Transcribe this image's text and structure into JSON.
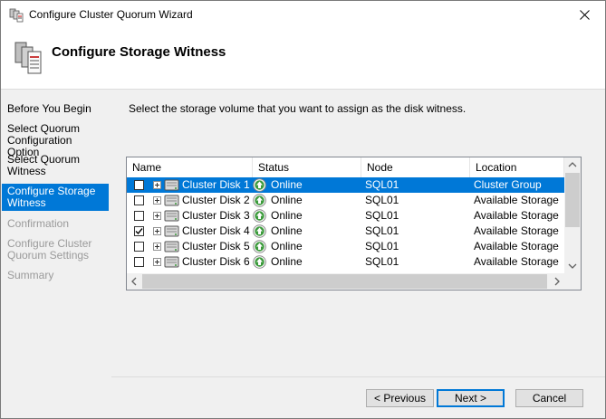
{
  "window": {
    "title": "Configure Cluster Quorum Wizard"
  },
  "header": {
    "title": "Configure Storage Witness"
  },
  "nav": [
    {
      "label": "Before You Begin",
      "state": "done"
    },
    {
      "label": "Select Quorum Configuration Option",
      "state": "done"
    },
    {
      "label": "Select Quorum Witness",
      "state": "done"
    },
    {
      "label": "Configure Storage Witness",
      "state": "active"
    },
    {
      "label": "Confirmation",
      "state": "disabled"
    },
    {
      "label": "Configure Cluster Quorum Settings",
      "state": "disabled"
    },
    {
      "label": "Summary",
      "state": "disabled"
    }
  ],
  "instruction": "Select the storage volume that you want to assign as the disk witness.",
  "grid": {
    "columns": [
      "Name",
      "Status",
      "Node",
      "Location"
    ],
    "rows": [
      {
        "name": "Cluster Disk 1",
        "status": "Online",
        "node": "SQL01",
        "location": "Cluster Group",
        "checked": false,
        "selected": true
      },
      {
        "name": "Cluster Disk 2",
        "status": "Online",
        "node": "SQL01",
        "location": "Available Storage",
        "checked": false,
        "selected": false
      },
      {
        "name": "Cluster Disk 3",
        "status": "Online",
        "node": "SQL01",
        "location": "Available Storage",
        "checked": false,
        "selected": false
      },
      {
        "name": "Cluster Disk 4",
        "status": "Online",
        "node": "SQL01",
        "location": "Available Storage",
        "checked": true,
        "selected": false
      },
      {
        "name": "Cluster Disk 5",
        "status": "Online",
        "node": "SQL01",
        "location": "Available Storage",
        "checked": false,
        "selected": false
      },
      {
        "name": "Cluster Disk 6",
        "status": "Online",
        "node": "SQL01",
        "location": "Available Storage",
        "checked": false,
        "selected": false
      }
    ]
  },
  "buttons": {
    "previous": "< Previous",
    "next": "Next >",
    "cancel": "Cancel"
  },
  "colors": {
    "accent": "#0078d7",
    "online": "#3c9a3c"
  },
  "icons": {
    "title": "cluster-server-icon",
    "close": "close-icon",
    "header": "cluster-server-icon",
    "disk": "disk-icon",
    "status": "online-arrow-icon"
  }
}
